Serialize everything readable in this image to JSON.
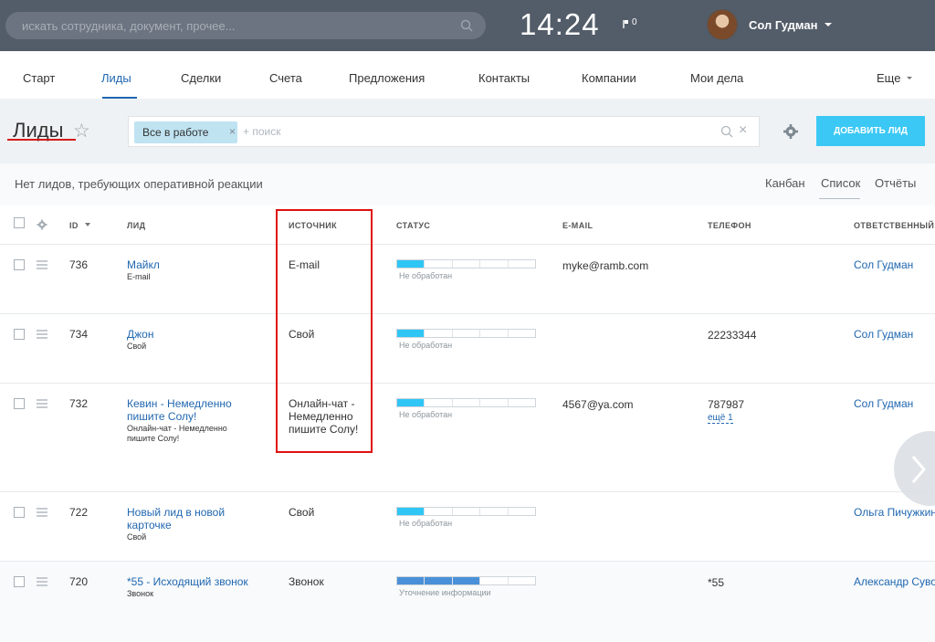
{
  "header": {
    "search_placeholder": "искать сотрудника, документ, прочее...",
    "clock": "14:24",
    "notifications_count": "0",
    "user_name": "Сол Гудман"
  },
  "nav": {
    "items": [
      "Старт",
      "Лиды",
      "Сделки",
      "Счета",
      "Предложения",
      "Контакты",
      "Компании",
      "Мои дела",
      "Еще"
    ],
    "active": "Лиды"
  },
  "toolbar": {
    "title": "Лиды",
    "filter_chip": "Все в работе",
    "filter_placeholder": "+ поиск",
    "add_button": "ДОБАВИТЬ ЛИД"
  },
  "info": {
    "text": "Нет лидов, требующих оперативной реакции",
    "views": [
      "Канбан",
      "Список",
      "Отчёты"
    ],
    "active_view": "Список"
  },
  "table": {
    "columns": [
      "ID",
      "ЛИД",
      "ИСТОЧНИК",
      "СТАТУС",
      "E-MAIL",
      "ТЕЛЕФОН",
      "ОТВЕТСТВЕННЫЙ"
    ],
    "rows": [
      {
        "id": "736",
        "lead": "Майкл",
        "lead_sub": "E-mail",
        "source": "E-mail",
        "status_text": "Не обработан",
        "status_progress": 0.2,
        "email": "myke@ramb.com",
        "phone": "",
        "phone_more": "",
        "responsible": "Сол Гудман"
      },
      {
        "id": "734",
        "lead": "Джон",
        "lead_sub": "Свой",
        "source": "Свой",
        "status_text": "Не обработан",
        "status_progress": 0.2,
        "email": "",
        "phone": "22233344",
        "phone_more": "",
        "responsible": "Сол Гудман"
      },
      {
        "id": "732",
        "lead": "Кевин - Немедленно пишите Солу!",
        "lead_sub": "Онлайн-чат - Немедленно пишите Солу!",
        "source": "Онлайн-чат - Немедленно пишите Солу!",
        "status_text": "Не обработан",
        "status_progress": 0.2,
        "email": "4567@ya.com",
        "phone": "787987",
        "phone_more": "ещё 1",
        "responsible": "Сол Гудман"
      },
      {
        "id": "722",
        "lead": "Новый лид в новой карточке",
        "lead_sub": "Свой",
        "source": "Свой",
        "status_text": "Не обработан",
        "status_progress": 0.2,
        "email": "",
        "phone": "",
        "phone_more": "",
        "responsible": "Ольга Пичужкина"
      },
      {
        "id": "720",
        "lead": "*55 - Исходящий звонок",
        "lead_sub": "Звонок",
        "source": "Звонок",
        "status_text": "Уточнение информации",
        "status_progress": 0.6,
        "email": "",
        "phone": "*55",
        "phone_more": "",
        "responsible": "Александр Суворов"
      }
    ]
  },
  "colors": {
    "topbar": "#535c69",
    "accent": "#3bc8f5",
    "link": "#2067b0",
    "status_new": "#2fc6f6",
    "status_info": "#4a90d9",
    "highlight": "#e01010"
  }
}
